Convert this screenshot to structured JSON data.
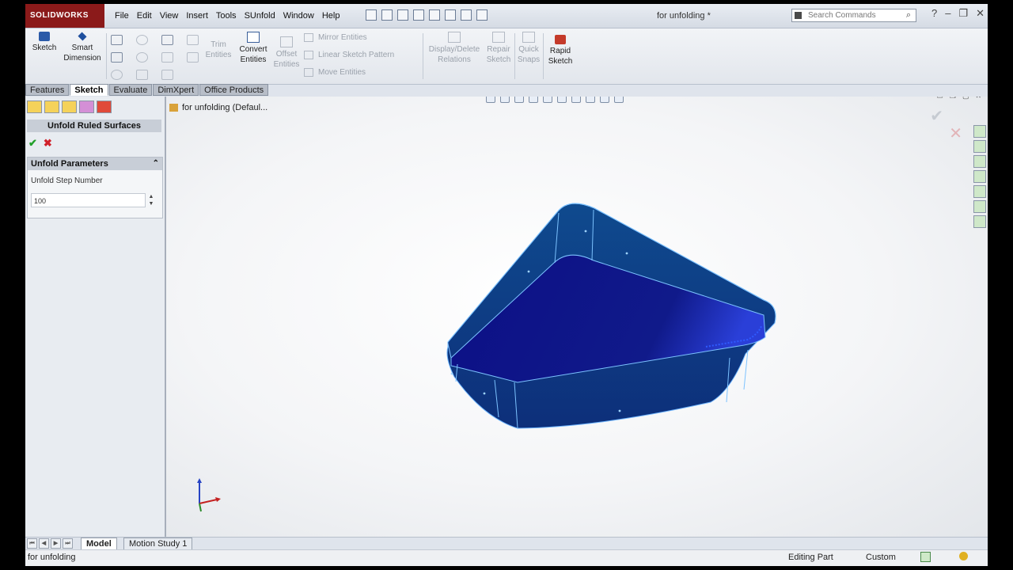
{
  "app": {
    "brand": "SOLIDWORKS",
    "document_title": "for unfolding *"
  },
  "menu": [
    "File",
    "Edit",
    "View",
    "Insert",
    "Tools",
    "SUnfold",
    "Window",
    "Help"
  ],
  "search": {
    "placeholder": "Search Commands"
  },
  "commands": {
    "sketch": "Sketch",
    "smart_dimension_1": "Smart",
    "smart_dimension_2": "Dimension",
    "trim_1": "Trim",
    "trim_2": "Entities",
    "convert_1": "Convert",
    "convert_2": "Entities",
    "offset_1": "Offset",
    "offset_2": "Entities",
    "mirror": "Mirror Entities",
    "linear_pattern": "Linear Sketch Pattern",
    "move": "Move Entities",
    "display_delete_1": "Display/Delete",
    "display_delete_2": "Relations",
    "repair_1": "Repair",
    "repair_2": "Sketch",
    "quick_snaps_1": "Quick",
    "quick_snaps_2": "Snaps",
    "rapid_1": "Rapid",
    "rapid_2": "Sketch"
  },
  "tabs": [
    "Features",
    "Sketch",
    "Evaluate",
    "DimXpert",
    "Office Products"
  ],
  "property_manager": {
    "title": "Unfold Ruled Surfaces",
    "group_title": "Unfold Parameters",
    "field_label": "Unfold Step Number",
    "field_value": "100"
  },
  "tree": {
    "root": "for unfolding  (Defaul..."
  },
  "bottom_tabs": [
    "Model",
    "Motion Study 1"
  ],
  "status": {
    "left": "for unfolding",
    "mode": "Editing Part",
    "units": "Custom"
  },
  "colors": {
    "part_face": "#101a8a",
    "part_wall": "#0f3f86",
    "edge": "#7cc2ff",
    "brand": "#8b1a1a"
  },
  "icons": [
    "sketch-icon",
    "smart-dimension-icon",
    "convert-entities-icon",
    "rapid-sketch-icon",
    "check-icon",
    "close-icon",
    "search-icon",
    "triad-icon"
  ]
}
